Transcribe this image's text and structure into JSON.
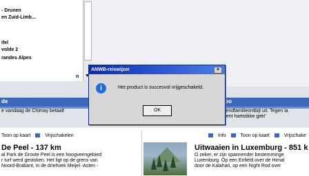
{
  "list_items": [
    "- Drunen",
    "en Zuid-Limb...",
    "ifel",
    "volde 2",
    "randes Alpes"
  ],
  "sort_label": "n",
  "header_left": "de",
  "header_right": "Too",
  "strip_text_left": "e vandaag de Chimay betaalt",
  "strip_text_right": "tiendfamilieontbijt uit. Tegen la\nbent hartstikke gek!'",
  "dialog": {
    "title": "ANWB-reiswijzer",
    "message": "Het product is succesvol vrijgeschakeld.",
    "ok": "OK",
    "close": "×",
    "icon": "i"
  },
  "toolbar_left": {
    "map": "Toon op kaart",
    "unlock": "Vrijschakelen"
  },
  "toolbar_right": {
    "info": "Info",
    "map": "Toon op kaart",
    "unlock": "Vrijschake"
  },
  "cards": [
    {
      "title": "De Peel - 137 km",
      "text": "al Park de Groote Peel is een hoogveengebied\nr turf werd gestoken. Het ligt op de grens van\nNoord-Brabant, in de driehoek Meijel -Asten -"
    },
    {
      "title": "Uitwaaien in Luxemburg - 851 k",
      "text": "O zeker, er zijn spannender bestemminge\nLuxemburg. Op een Enfield over de Himal\ndoor de Kalahari, op een Night Rod over"
    }
  ]
}
